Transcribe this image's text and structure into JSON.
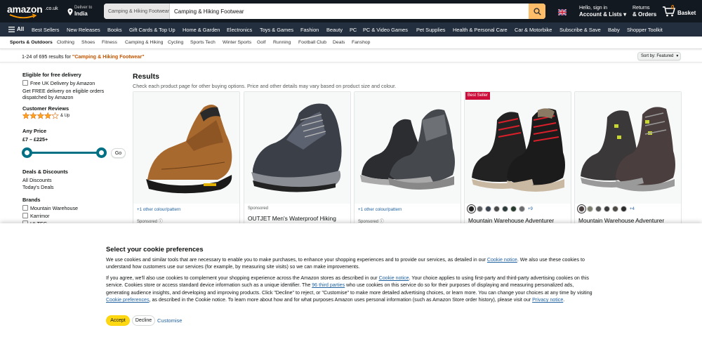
{
  "header": {
    "logo_text": "amazon",
    "logo_tld": ".co.uk",
    "deliver_line1": "Deliver to",
    "deliver_line2": "India",
    "search_category": "Camping & Hiking Footwear",
    "search_value": "Camping & Hiking Footwear",
    "account_line1": "Hello, sign in",
    "account_line2": "Account & Lists ▾",
    "returns_line1": "Returns",
    "returns_line2": "& Orders",
    "basket_count": "0",
    "basket_label": "Basket"
  },
  "nav": {
    "all_label": "All",
    "items": [
      "Best Sellers",
      "New Releases",
      "Books",
      "Gift Cards & Top Up",
      "Home & Garden",
      "Electronics",
      "Toys & Games",
      "Fashion",
      "Beauty",
      "PC",
      "PC & Video Games",
      "Pet Supplies",
      "Health & Personal Care",
      "Car & Motorbike",
      "Subscribe & Save",
      "Baby",
      "Shopper Toolkit"
    ]
  },
  "subnav": {
    "items": [
      "Sports & Outdoors",
      "Clothing",
      "Shoes",
      "Fitness",
      "Camping & Hiking",
      "Cycling",
      "Sports Tech",
      "Winter Sports",
      "Golf",
      "Running",
      "Football Club",
      "Deals",
      "Fanshop"
    ]
  },
  "results_bar": {
    "count_text": "1-24 of 695 results for ",
    "query": "\"Camping & Hiking Footwear\"",
    "sort_label": "Sort by:",
    "sort_value": "Featured"
  },
  "sidebar": {
    "free_delivery_heading": "Eligible for free delivery",
    "free_uk_label": "Free UK Delivery by Amazon",
    "free_note": "Get FREE delivery on eligible orders dispatched by Amazon",
    "reviews_heading": "Customer Reviews",
    "stars": 4,
    "reviews_up": "& Up",
    "price_heading": "Any Price",
    "price_range": "£7 – £225+",
    "go_label": "Go",
    "deals_heading": "Deals & Discounts",
    "deals_items": [
      "All Discounts",
      "Today's Deals"
    ],
    "brands_heading": "Brands",
    "brands": [
      "Mountain Warehouse",
      "Karrimor",
      "HI-TEC"
    ]
  },
  "main": {
    "results_title": "Results",
    "results_sub": "Check each product page for other buying options. Price and other details may vary based on product size and colour.",
    "best_seller_badge": "Best Seller",
    "products": [
      {
        "meta": "+1 other colour/pattern",
        "sponsored": "Sponsored",
        "title": ""
      },
      {
        "meta": "",
        "sponsored": "Sponsored",
        "title": "OUTJET Men's Waterproof Hiking"
      },
      {
        "meta": "+1 other colour/pattern",
        "sponsored": "Sponsored",
        "title": ""
      },
      {
        "meta": "+9",
        "sponsored": "",
        "title": "Mountain Warehouse Adventurer"
      },
      {
        "meta": "+4",
        "sponsored": "",
        "title": "Mountain Warehouse Adventurer"
      }
    ]
  },
  "cookie": {
    "title": "Select your cookie preferences",
    "p1_a": "We use cookies and similar tools that are necessary to enable you to make purchases, to enhance your shopping experiences and to provide our services, as detailed in our ",
    "p1_link": "Cookie notice",
    "p1_b": ". We also use these cookies to understand how customers use our services (for example, by measuring site visits) so we can make improvements.",
    "p2_a": "If you agree, we'll also use cookies to complement your shopping experience across the Amazon stores as described in our ",
    "p2_link1": "Cookie notice",
    "p2_b": ". Your choice applies to using first-party and third-party advertising cookies on this service. Cookies store or access standard device information such as a unique identifier. The ",
    "p2_link2": "96 third parties",
    "p2_c": " who use cookies on this service do so for their purposes of displaying and measuring personalized ads, generating audience insights, and developing and improving products. Click \"Decline\" to reject, or \"Customise\" to make more detailed advertising choices, or learn more. You can change your choices at any time by visiting ",
    "p2_link3": "Cookie preferences",
    "p2_d": ", as described in the Cookie notice. To learn more about how and for what purposes Amazon uses personal information (such as Amazon Store order history), please visit our ",
    "p2_link4": "Privacy notice",
    "p2_e": ".",
    "accept": "Accept",
    "decline": "Decline",
    "customise": "Customise"
  },
  "colors": {
    "header_bg": "#131921",
    "nav_bg": "#232f3e",
    "accent": "#febd69",
    "link": "#2162a1",
    "slider": "#007185",
    "accept_btn": "#ffd814",
    "best_seller": "#cc0c39",
    "query_text": "#c45500"
  }
}
